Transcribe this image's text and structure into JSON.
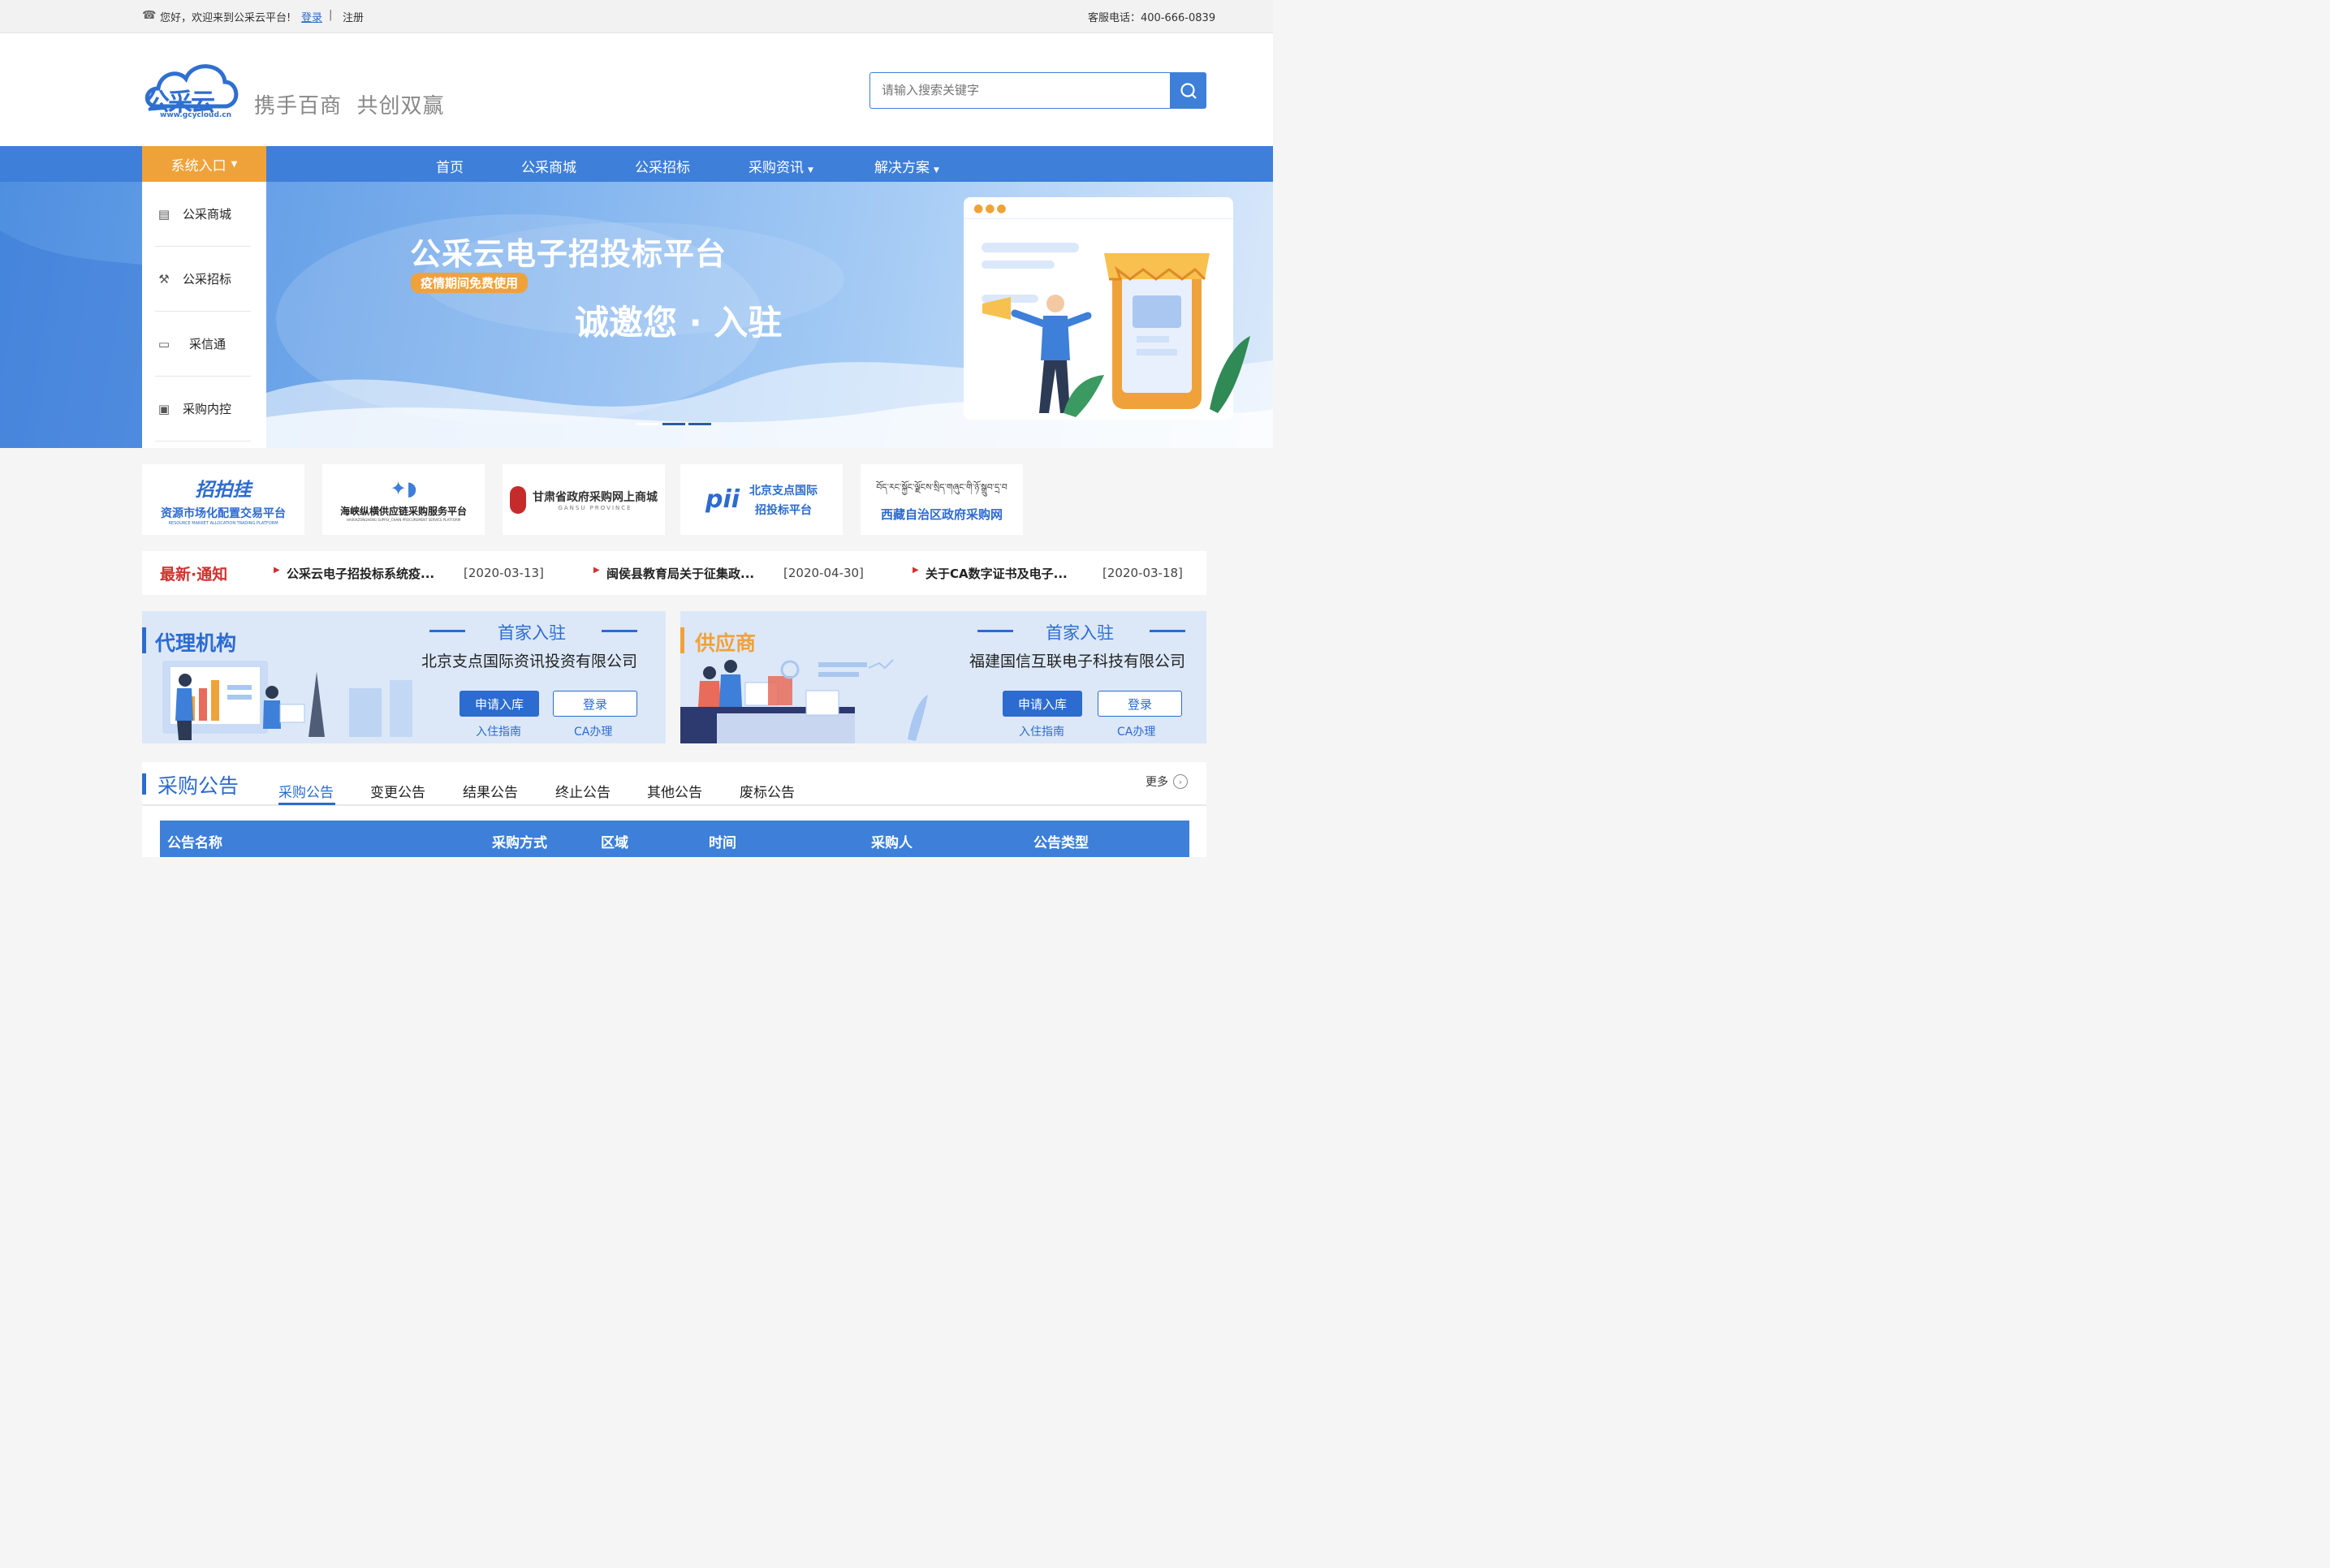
{
  "topbar": {
    "greeting": "您好，欢迎来到公采云平台!",
    "login": "登录",
    "divider": "|",
    "register": "注册",
    "hotline": "客服电话：400-666-0839"
  },
  "header": {
    "logo_text": "公采云",
    "logo_url": "www.gcycloud.cn",
    "slogan": "携手百商  共创双赢",
    "search_placeholder": "请输入搜索关键字"
  },
  "nav": {
    "system_entry": "系统入口",
    "items": [
      "首页",
      "公采商城",
      "公采招标",
      "采购资讯",
      "解决方案"
    ]
  },
  "sidebar": {
    "items": [
      "公采商城",
      "公采招标",
      "采信通",
      "采购内控"
    ]
  },
  "hero": {
    "title": "公采云电子招投标平台",
    "badge": "疫情期间免费使用",
    "subtitle": "诚邀您 · 入驻"
  },
  "partners": [
    {
      "title": "招拍挂",
      "subtitle": "资源市场化配置交易平台",
      "en": "RESOURCE MARKET ALLOCATION TRADING PLATFORM"
    },
    {
      "title": "海峡纵横供应链采购服务平台",
      "en": "HAIXIAZONGHENG SUPPLY_CHAIN PROCUREMENT SERVICE PLATFORM"
    },
    {
      "title": "甘肃省政府采购网上商城",
      "en": "GANSU PROVINCE"
    },
    {
      "title": "北京支点国际",
      "subtitle": "招投标平台"
    },
    {
      "tibetan": "བོད་རང་སྐྱོང་ལྗོངས་སྲིད་གཞུང་གི་ཉོ་སྒྲུབ་དྲ་བ",
      "title": "西藏自治区政府采购网"
    }
  ],
  "notice": {
    "label": "最新·通知",
    "items": [
      {
        "text": "公采云电子招投标系统疫...",
        "date": "[2020-03-13]"
      },
      {
        "text": "闽侯县教育局关于征集政...",
        "date": "[2020-04-30]"
      },
      {
        "text": "关于CA数字证书及电子...",
        "date": "[2020-03-18]"
      }
    ]
  },
  "cards": [
    {
      "title": "代理机构",
      "first": "首家入驻",
      "company": "北京支点国际资讯投资有限公司",
      "apply": "申请入库",
      "login": "登录",
      "guide": "入住指南",
      "ca": "CA办理"
    },
    {
      "title": "供应商",
      "first": "首家入驻",
      "company": "福建国信互联电子科技有限公司",
      "apply": "申请入库",
      "login": "登录",
      "guide": "入住指南",
      "ca": "CA办理"
    }
  ],
  "announcements": {
    "title": "采购公告",
    "tabs": [
      "采购公告",
      "变更公告",
      "结果公告",
      "终止公告",
      "其他公告",
      "废标公告"
    ],
    "more": "更多",
    "columns": [
      "公告名称",
      "采购方式",
      "区域",
      "时间",
      "采购人",
      "公告类型"
    ]
  },
  "colors": {
    "primary": "#3d7fd9",
    "orange": "#f0a23a",
    "notice_red": "#d0312d",
    "button_blue": "#2c6bd0"
  }
}
